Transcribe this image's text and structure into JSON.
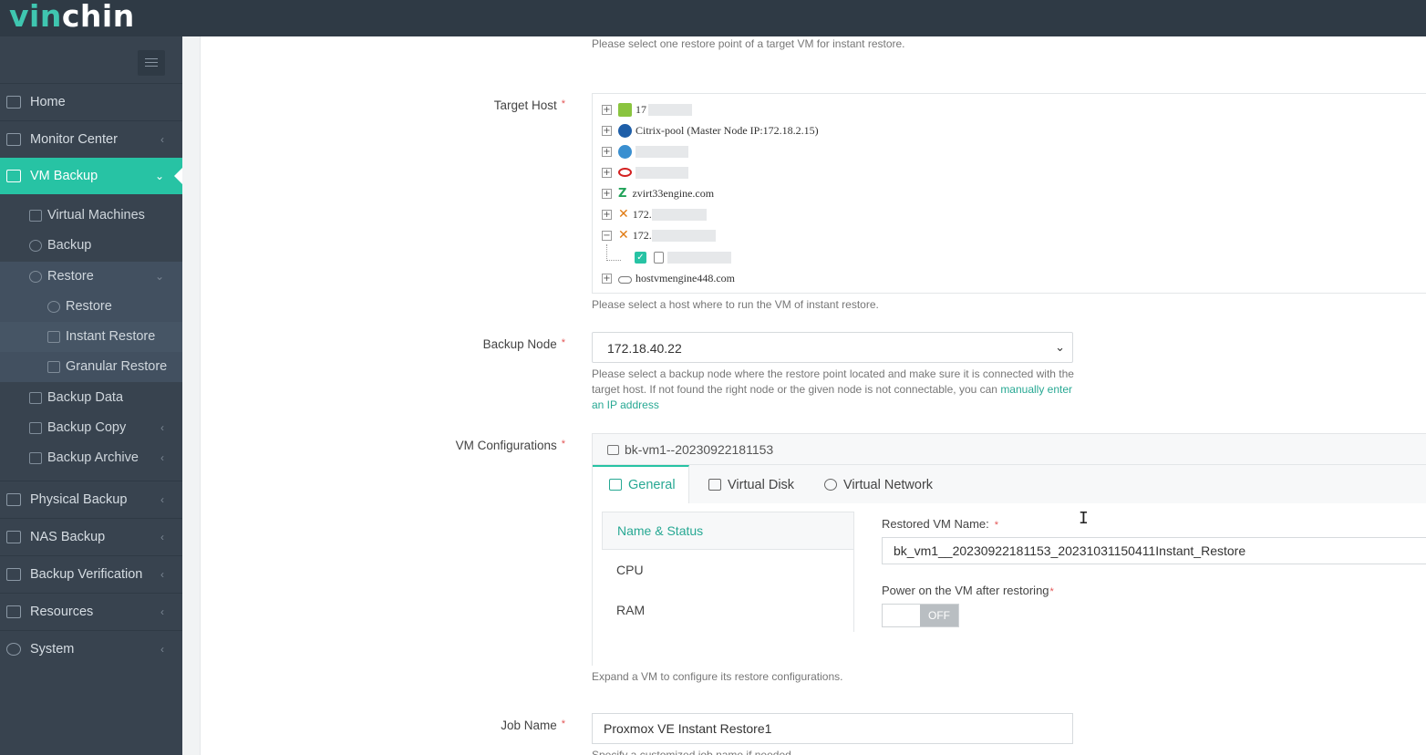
{
  "app": {
    "logo_part1": "vin",
    "logo_part2": "chin",
    "accent_color": "#27c3a4"
  },
  "sidebar": {
    "menu_icon": "hamburger-icon",
    "items": [
      {
        "label": "Home",
        "icon": "home-icon"
      },
      {
        "label": "Monitor Center",
        "icon": "monitor-icon",
        "chevron": "‹"
      },
      {
        "label": "VM Backup",
        "icon": "vm-icon",
        "chevron": "⌄",
        "active": true
      },
      {
        "label": "Physical Backup",
        "icon": "physical-icon",
        "chevron": "‹"
      },
      {
        "label": "NAS Backup",
        "icon": "nas-icon",
        "chevron": "‹"
      },
      {
        "label": "Backup Verification",
        "icon": "verification-icon",
        "chevron": "‹"
      },
      {
        "label": "Resources",
        "icon": "resources-icon",
        "chevron": "‹"
      },
      {
        "label": "System",
        "icon": "gear-icon",
        "chevron": "‹"
      }
    ],
    "vm_backup_sub": [
      {
        "label": "Virtual Machines"
      },
      {
        "label": "Backup"
      },
      {
        "label": "Restore",
        "chevron": "⌄"
      },
      {
        "label": "Restore"
      },
      {
        "label": "Instant Restore"
      },
      {
        "label": "Granular Restore"
      },
      {
        "label": "Backup Data"
      },
      {
        "label": "Backup Copy",
        "chevron": "‹"
      },
      {
        "label": "Backup Archive",
        "chevron": "‹"
      }
    ]
  },
  "form": {
    "restore_point_hint": "Please select one restore point of a target VM for instant restore.",
    "target_host": {
      "label": "Target Host",
      "required": "*",
      "nodes": [
        {
          "text": "17",
          "expand": "+"
        },
        {
          "text": "Citrix-pool (Master Node IP:172.18.2.15)",
          "expand": "+"
        },
        {
          "text": "",
          "expand": "+"
        },
        {
          "text": "",
          "expand": "+"
        },
        {
          "text": "zvirt33engine.com",
          "expand": "+"
        },
        {
          "text": "172.",
          "expand": "+"
        },
        {
          "text": "172.",
          "expand": "−"
        },
        {
          "text": "",
          "expand": ""
        },
        {
          "text": "hostvmengine448.com",
          "expand": "+"
        }
      ],
      "hint": "Please select a host where to run the VM of instant restore."
    },
    "backup_node": {
      "label": "Backup Node",
      "required": "*",
      "value": "172.18.40.22",
      "hint_text": "Please select a backup node where the restore point located and make sure it is connected with the target host. If not found the right node or the given node is not connectable, you can ",
      "hint_link": "manually enter an IP address"
    },
    "vm_config": {
      "label": "VM Configurations",
      "required": "*",
      "vm_name": "bk-vm1--20230922181153",
      "tabs": [
        "General",
        "Virtual Disk",
        "Virtual Network"
      ],
      "side_items": [
        "Name & Status",
        "CPU",
        "RAM"
      ],
      "restored_name_label": "Restored VM Name:",
      "restored_name_required": "*",
      "restored_name_value": "bk_vm1__20230922181153_20231031150411Instant_Restore",
      "power_label": "Power on the VM after restoring",
      "power_required": "*",
      "power_state": "OFF",
      "hint": "Expand a VM to configure its restore configurations."
    },
    "job_name": {
      "label": "Job Name",
      "required": "*",
      "value": "Proxmox VE Instant Restore1",
      "hint": "Specify a customized job name if needed"
    }
  }
}
